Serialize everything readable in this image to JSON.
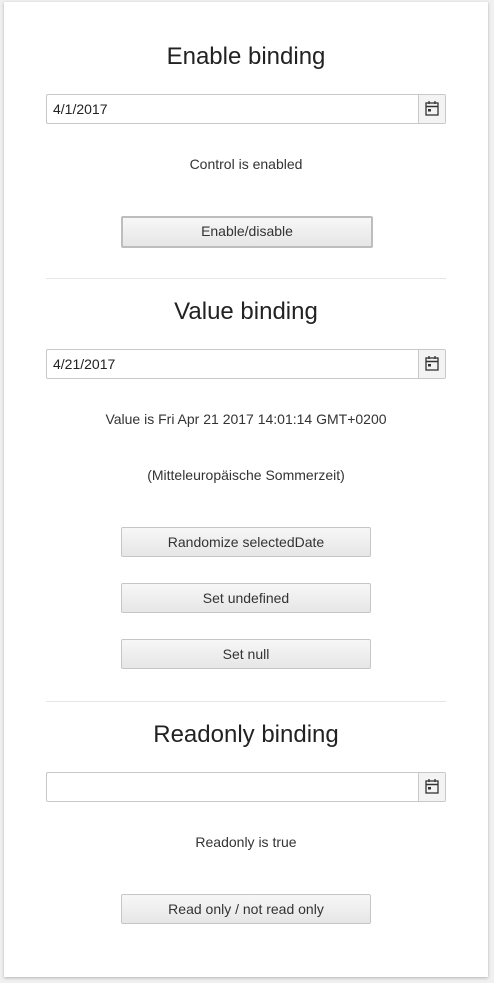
{
  "sections": {
    "enable": {
      "title": "Enable binding",
      "date_value": "4/1/2017",
      "status": "Control is enabled",
      "button": "Enable/disable"
    },
    "value": {
      "title": "Value binding",
      "date_value": "4/21/2017",
      "status_line1": "Value is Fri Apr 21 2017 14:01:14 GMT+0200",
      "status_line2": "(Mitteleuropäische Sommerzeit)",
      "buttons": [
        "Randomize selectedDate",
        "Set undefined",
        "Set null"
      ]
    },
    "readonly": {
      "title": "Readonly binding",
      "date_value": "",
      "status": "Readonly is true",
      "button": "Read only / not read only"
    }
  },
  "icons": {
    "calendar": "calendar-icon"
  }
}
